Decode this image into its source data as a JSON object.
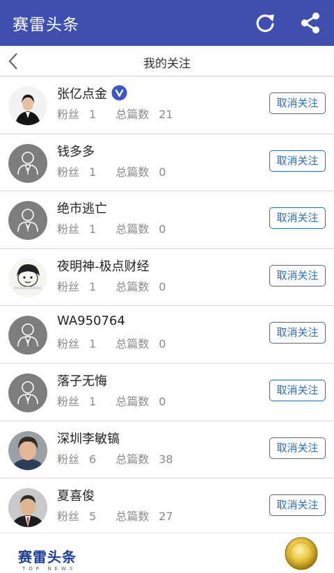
{
  "app": {
    "title": "赛雷头条",
    "icons": {
      "refresh": "refresh-icon",
      "share": "share-icon"
    },
    "colors": {
      "appbar": "#3f4fb0",
      "accent": "#2a6fc4",
      "badge": "#3a57c6"
    }
  },
  "page": {
    "title": "我的关注",
    "back_icon": "chevron-left-icon"
  },
  "labels": {
    "fans": "粉丝",
    "total": "总篇数",
    "unfollow": "取消关注"
  },
  "follows": [
    {
      "name": "张亿点金",
      "fans": "1",
      "total": "21",
      "verified": true,
      "avatar": "photo-man-suit"
    },
    {
      "name": "钱多多",
      "fans": "1",
      "total": "0",
      "verified": false,
      "avatar": "default-person"
    },
    {
      "name": "绝市逃亡",
      "fans": "1",
      "total": "0",
      "verified": false,
      "avatar": "default-person"
    },
    {
      "name": "夜明神-极点财经",
      "fans": "1",
      "total": "0",
      "verified": false,
      "avatar": "cartoon-face"
    },
    {
      "name": "WA950764",
      "fans": "1",
      "total": "0",
      "verified": false,
      "avatar": "default-person"
    },
    {
      "name": "落子无悔",
      "fans": "1",
      "total": "0",
      "verified": false,
      "avatar": "default-person"
    },
    {
      "name": "深圳李敏镐",
      "fans": "6",
      "total": "38",
      "verified": false,
      "avatar": "photo-young-man"
    },
    {
      "name": "夏喜俊",
      "fans": "5",
      "total": "27",
      "verified": false,
      "avatar": "photo-man-red-tie"
    }
  ],
  "footer": {
    "logo_cn": "赛雷头条",
    "logo_en": "TOP NEWS"
  }
}
